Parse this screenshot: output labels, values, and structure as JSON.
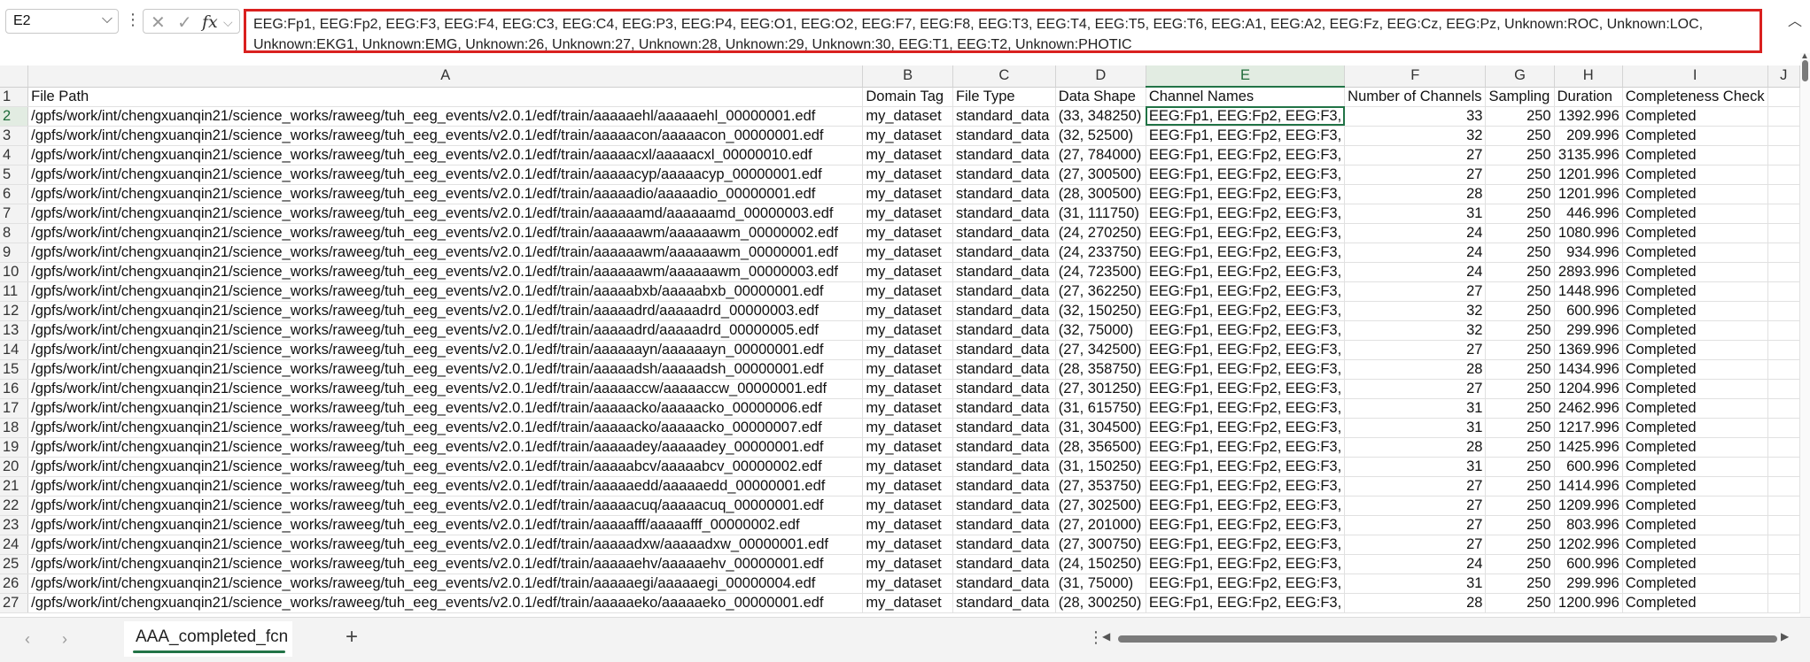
{
  "formula_bar": {
    "name_box": "E2",
    "formula": "EEG:Fp1, EEG:Fp2, EEG:F3, EEG:F4, EEG:C3, EEG:C4, EEG:P3, EEG:P4, EEG:O1, EEG:O2, EEG:F7, EEG:F8, EEG:T3, EEG:T4, EEG:T5, EEG:T6, EEG:A1, EEG:A2, EEG:Fz, EEG:Cz, EEG:Pz, Unknown:ROC, Unknown:LOC, Unknown:EKG1, Unknown:EMG, Unknown:26, Unknown:27, Unknown:28, Unknown:29, Unknown:30, EEG:T1, EEG:T2, Unknown:PHOTIC"
  },
  "icons": {
    "name_box_dropdown": "chevron-down-icon",
    "cancel": "close-icon",
    "enter": "check-icon",
    "function": "fx-icon",
    "collapse": "chevron-up-icon"
  },
  "columns": [
    "A",
    "B",
    "C",
    "D",
    "E",
    "F",
    "G",
    "H",
    "I",
    "J"
  ],
  "selected_column": "E",
  "header_row": {
    "row_number": "1",
    "cells": [
      "File Path",
      "Domain Tag",
      "File Type",
      "Data Shape",
      "Channel Names",
      "Number of Channels",
      "Sampling",
      "Duration",
      "Completeness Check",
      ""
    ]
  },
  "rows": [
    {
      "n": "2",
      "path": "/gpfs/work/int/chengxuanqin21/science_works/raweeg/tuh_eeg_events/v2.0.1/edf/train/aaaaaehl/aaaaaehl_00000001.edf",
      "tag": "my_dataset",
      "type": "standard_data",
      "shape": "(33, 348250)",
      "channels": "EEG:Fp1, EEG:Fp2, EEG:F3,",
      "nch": "33",
      "sampling": "250",
      "duration": "1392.996",
      "check": "Completed"
    },
    {
      "n": "3",
      "path": "/gpfs/work/int/chengxuanqin21/science_works/raweeg/tuh_eeg_events/v2.0.1/edf/train/aaaaacon/aaaaacon_00000001.edf",
      "tag": "my_dataset",
      "type": "standard_data",
      "shape": "(32, 52500)",
      "channels": "EEG:Fp1, EEG:Fp2, EEG:F3,",
      "nch": "32",
      "sampling": "250",
      "duration": "209.996",
      "check": "Completed"
    },
    {
      "n": "4",
      "path": "/gpfs/work/int/chengxuanqin21/science_works/raweeg/tuh_eeg_events/v2.0.1/edf/train/aaaaacxl/aaaaacxl_00000010.edf",
      "tag": "my_dataset",
      "type": "standard_data",
      "shape": "(27, 784000)",
      "channels": "EEG:Fp1, EEG:Fp2, EEG:F3,",
      "nch": "27",
      "sampling": "250",
      "duration": "3135.996",
      "check": "Completed"
    },
    {
      "n": "5",
      "path": "/gpfs/work/int/chengxuanqin21/science_works/raweeg/tuh_eeg_events/v2.0.1/edf/train/aaaaacyp/aaaaacyp_00000001.edf",
      "tag": "my_dataset",
      "type": "standard_data",
      "shape": "(27, 300500)",
      "channels": "EEG:Fp1, EEG:Fp2, EEG:F3,",
      "nch": "27",
      "sampling": "250",
      "duration": "1201.996",
      "check": "Completed"
    },
    {
      "n": "6",
      "path": "/gpfs/work/int/chengxuanqin21/science_works/raweeg/tuh_eeg_events/v2.0.1/edf/train/aaaaadio/aaaaadio_00000001.edf",
      "tag": "my_dataset",
      "type": "standard_data",
      "shape": "(28, 300500)",
      "channels": "EEG:Fp1, EEG:Fp2, EEG:F3,",
      "nch": "28",
      "sampling": "250",
      "duration": "1201.996",
      "check": "Completed"
    },
    {
      "n": "7",
      "path": "/gpfs/work/int/chengxuanqin21/science_works/raweeg/tuh_eeg_events/v2.0.1/edf/train/aaaaaamd/aaaaaamd_00000003.edf",
      "tag": "my_dataset",
      "type": "standard_data",
      "shape": "(31, 111750)",
      "channels": "EEG:Fp1, EEG:Fp2, EEG:F3,",
      "nch": "31",
      "sampling": "250",
      "duration": "446.996",
      "check": "Completed"
    },
    {
      "n": "8",
      "path": "/gpfs/work/int/chengxuanqin21/science_works/raweeg/tuh_eeg_events/v2.0.1/edf/train/aaaaaawm/aaaaaawm_00000002.edf",
      "tag": "my_dataset",
      "type": "standard_data",
      "shape": "(24, 270250)",
      "channels": "EEG:Fp1, EEG:Fp2, EEG:F3,",
      "nch": "24",
      "sampling": "250",
      "duration": "1080.996",
      "check": "Completed"
    },
    {
      "n": "9",
      "path": "/gpfs/work/int/chengxuanqin21/science_works/raweeg/tuh_eeg_events/v2.0.1/edf/train/aaaaaawm/aaaaaawm_00000001.edf",
      "tag": "my_dataset",
      "type": "standard_data",
      "shape": "(24, 233750)",
      "channels": "EEG:Fp1, EEG:Fp2, EEG:F3,",
      "nch": "24",
      "sampling": "250",
      "duration": "934.996",
      "check": "Completed"
    },
    {
      "n": "10",
      "path": "/gpfs/work/int/chengxuanqin21/science_works/raweeg/tuh_eeg_events/v2.0.1/edf/train/aaaaaawm/aaaaaawm_00000003.edf",
      "tag": "my_dataset",
      "type": "standard_data",
      "shape": "(24, 723500)",
      "channels": "EEG:Fp1, EEG:Fp2, EEG:F3,",
      "nch": "24",
      "sampling": "250",
      "duration": "2893.996",
      "check": "Completed"
    },
    {
      "n": "11",
      "path": "/gpfs/work/int/chengxuanqin21/science_works/raweeg/tuh_eeg_events/v2.0.1/edf/train/aaaaabxb/aaaaabxb_00000001.edf",
      "tag": "my_dataset",
      "type": "standard_data",
      "shape": "(27, 362250)",
      "channels": "EEG:Fp1, EEG:Fp2, EEG:F3,",
      "nch": "27",
      "sampling": "250",
      "duration": "1448.996",
      "check": "Completed"
    },
    {
      "n": "12",
      "path": "/gpfs/work/int/chengxuanqin21/science_works/raweeg/tuh_eeg_events/v2.0.1/edf/train/aaaaadrd/aaaaadrd_00000003.edf",
      "tag": "my_dataset",
      "type": "standard_data",
      "shape": "(32, 150250)",
      "channels": "EEG:Fp1, EEG:Fp2, EEG:F3,",
      "nch": "32",
      "sampling": "250",
      "duration": "600.996",
      "check": "Completed"
    },
    {
      "n": "13",
      "path": "/gpfs/work/int/chengxuanqin21/science_works/raweeg/tuh_eeg_events/v2.0.1/edf/train/aaaaadrd/aaaaadrd_00000005.edf",
      "tag": "my_dataset",
      "type": "standard_data",
      "shape": "(32, 75000)",
      "channels": "EEG:Fp1, EEG:Fp2, EEG:F3,",
      "nch": "32",
      "sampling": "250",
      "duration": "299.996",
      "check": "Completed"
    },
    {
      "n": "14",
      "path": "/gpfs/work/int/chengxuanqin21/science_works/raweeg/tuh_eeg_events/v2.0.1/edf/train/aaaaaayn/aaaaaayn_00000001.edf",
      "tag": "my_dataset",
      "type": "standard_data",
      "shape": "(27, 342500)",
      "channels": "EEG:Fp1, EEG:Fp2, EEG:F3,",
      "nch": "27",
      "sampling": "250",
      "duration": "1369.996",
      "check": "Completed"
    },
    {
      "n": "15",
      "path": "/gpfs/work/int/chengxuanqin21/science_works/raweeg/tuh_eeg_events/v2.0.1/edf/train/aaaaadsh/aaaaadsh_00000001.edf",
      "tag": "my_dataset",
      "type": "standard_data",
      "shape": "(28, 358750)",
      "channels": "EEG:Fp1, EEG:Fp2, EEG:F3,",
      "nch": "28",
      "sampling": "250",
      "duration": "1434.996",
      "check": "Completed"
    },
    {
      "n": "16",
      "path": "/gpfs/work/int/chengxuanqin21/science_works/raweeg/tuh_eeg_events/v2.0.1/edf/train/aaaaaccw/aaaaaccw_00000001.edf",
      "tag": "my_dataset",
      "type": "standard_data",
      "shape": "(27, 301250)",
      "channels": "EEG:Fp1, EEG:Fp2, EEG:F3,",
      "nch": "27",
      "sampling": "250",
      "duration": "1204.996",
      "check": "Completed"
    },
    {
      "n": "17",
      "path": "/gpfs/work/int/chengxuanqin21/science_works/raweeg/tuh_eeg_events/v2.0.1/edf/train/aaaaacko/aaaaacko_00000006.edf",
      "tag": "my_dataset",
      "type": "standard_data",
      "shape": "(31, 615750)",
      "channels": "EEG:Fp1, EEG:Fp2, EEG:F3,",
      "nch": "31",
      "sampling": "250",
      "duration": "2462.996",
      "check": "Completed"
    },
    {
      "n": "18",
      "path": "/gpfs/work/int/chengxuanqin21/science_works/raweeg/tuh_eeg_events/v2.0.1/edf/train/aaaaacko/aaaaacko_00000007.edf",
      "tag": "my_dataset",
      "type": "standard_data",
      "shape": "(31, 304500)",
      "channels": "EEG:Fp1, EEG:Fp2, EEG:F3,",
      "nch": "31",
      "sampling": "250",
      "duration": "1217.996",
      "check": "Completed"
    },
    {
      "n": "19",
      "path": "/gpfs/work/int/chengxuanqin21/science_works/raweeg/tuh_eeg_events/v2.0.1/edf/train/aaaaadey/aaaaadey_00000001.edf",
      "tag": "my_dataset",
      "type": "standard_data",
      "shape": "(28, 356500)",
      "channels": "EEG:Fp1, EEG:Fp2, EEG:F3,",
      "nch": "28",
      "sampling": "250",
      "duration": "1425.996",
      "check": "Completed"
    },
    {
      "n": "20",
      "path": "/gpfs/work/int/chengxuanqin21/science_works/raweeg/tuh_eeg_events/v2.0.1/edf/train/aaaaabcv/aaaaabcv_00000002.edf",
      "tag": "my_dataset",
      "type": "standard_data",
      "shape": "(31, 150250)",
      "channels": "EEG:Fp1, EEG:Fp2, EEG:F3,",
      "nch": "31",
      "sampling": "250",
      "duration": "600.996",
      "check": "Completed"
    },
    {
      "n": "21",
      "path": "/gpfs/work/int/chengxuanqin21/science_works/raweeg/tuh_eeg_events/v2.0.1/edf/train/aaaaaedd/aaaaaedd_00000001.edf",
      "tag": "my_dataset",
      "type": "standard_data",
      "shape": "(27, 353750)",
      "channels": "EEG:Fp1, EEG:Fp2, EEG:F3,",
      "nch": "27",
      "sampling": "250",
      "duration": "1414.996",
      "check": "Completed"
    },
    {
      "n": "22",
      "path": "/gpfs/work/int/chengxuanqin21/science_works/raweeg/tuh_eeg_events/v2.0.1/edf/train/aaaaacuq/aaaaacuq_00000001.edf",
      "tag": "my_dataset",
      "type": "standard_data",
      "shape": "(27, 302500)",
      "channels": "EEG:Fp1, EEG:Fp2, EEG:F3,",
      "nch": "27",
      "sampling": "250",
      "duration": "1209.996",
      "check": "Completed"
    },
    {
      "n": "23",
      "path": "/gpfs/work/int/chengxuanqin21/science_works/raweeg/tuh_eeg_events/v2.0.1/edf/train/aaaaafff/aaaaafff_00000002.edf",
      "tag": "my_dataset",
      "type": "standard_data",
      "shape": "(27, 201000)",
      "channels": "EEG:Fp1, EEG:Fp2, EEG:F3,",
      "nch": "27",
      "sampling": "250",
      "duration": "803.996",
      "check": "Completed"
    },
    {
      "n": "24",
      "path": "/gpfs/work/int/chengxuanqin21/science_works/raweeg/tuh_eeg_events/v2.0.1/edf/train/aaaaadxw/aaaaadxw_00000001.edf",
      "tag": "my_dataset",
      "type": "standard_data",
      "shape": "(27, 300750)",
      "channels": "EEG:Fp1, EEG:Fp2, EEG:F3,",
      "nch": "27",
      "sampling": "250",
      "duration": "1202.996",
      "check": "Completed"
    },
    {
      "n": "25",
      "path": "/gpfs/work/int/chengxuanqin21/science_works/raweeg/tuh_eeg_events/v2.0.1/edf/train/aaaaaehv/aaaaaehv_00000001.edf",
      "tag": "my_dataset",
      "type": "standard_data",
      "shape": "(24, 150250)",
      "channels": "EEG:Fp1, EEG:Fp2, EEG:F3,",
      "nch": "24",
      "sampling": "250",
      "duration": "600.996",
      "check": "Completed"
    },
    {
      "n": "26",
      "path": "/gpfs/work/int/chengxuanqin21/science_works/raweeg/tuh_eeg_events/v2.0.1/edf/train/aaaaaegi/aaaaaegi_00000004.edf",
      "tag": "my_dataset",
      "type": "standard_data",
      "shape": "(31, 75000)",
      "channels": "EEG:Fp1, EEG:Fp2, EEG:F3,",
      "nch": "31",
      "sampling": "250",
      "duration": "299.996",
      "check": "Completed"
    },
    {
      "n": "27",
      "path": "/gpfs/work/int/chengxuanqin21/science_works/raweeg/tuh_eeg_events/v2.0.1/edf/train/aaaaaeko/aaaaaeko_00000001.edf",
      "tag": "my_dataset",
      "type": "standard_data",
      "shape": "(28, 300250)",
      "channels": "EEG:Fp1, EEG:Fp2, EEG:F3,",
      "nch": "28",
      "sampling": "250",
      "duration": "1200.996",
      "check": "Completed"
    }
  ],
  "sheet_tabs": [
    {
      "label": "AAA_completed_fcn",
      "active": true
    }
  ],
  "accent_color": "#217346",
  "highlight_color": "#d9201f"
}
